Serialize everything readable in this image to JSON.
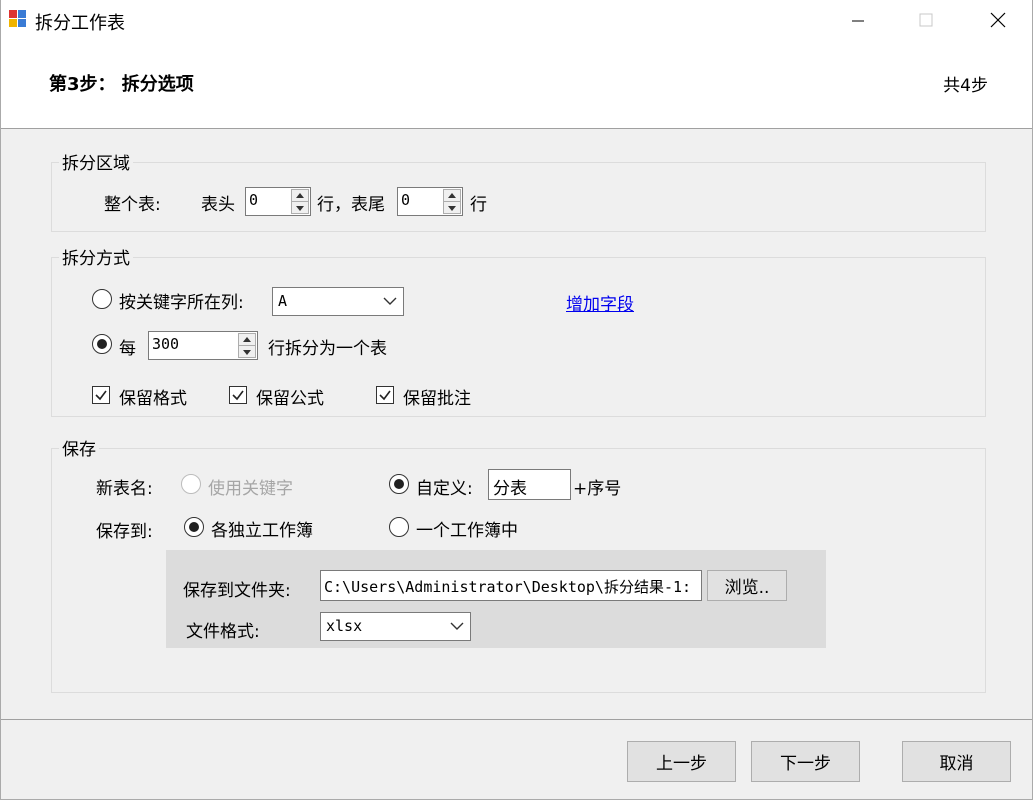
{
  "window": {
    "title": "拆分工作表",
    "minimize_glyph": "—",
    "close_glyph": "✕"
  },
  "header": {
    "step_title": "第3步： 拆分选项",
    "step_count": "共4步"
  },
  "split_range": {
    "legend": "拆分区域",
    "whole_sheet_label": "整个表:",
    "header_label": "表头",
    "header_rows": "0",
    "rows_suffix_1": "行，表尾",
    "footer_rows": "0",
    "rows_suffix_2": "行"
  },
  "split_method": {
    "legend": "拆分方式",
    "by_key_column_label": "按关键字所在列:",
    "by_key_column_checked": false,
    "key_column_value": "A",
    "add_field_link": "增加字段",
    "every_label": "每",
    "every_checked": true,
    "rows_per_sheet": "300",
    "rows_per_sheet_suffix": "行拆分为一个表",
    "keep_format_label": "保留格式",
    "keep_format_checked": true,
    "keep_formula_label": "保留公式",
    "keep_formula_checked": true,
    "keep_comment_label": "保留批注",
    "keep_comment_checked": true
  },
  "save": {
    "legend": "保存",
    "new_sheet_name_label": "新表名:",
    "use_keyword_label": "使用关键字",
    "custom_label": "自定义:",
    "custom_checked": true,
    "custom_value": "分表",
    "serial_suffix": "+序号",
    "save_to_label": "保存到:",
    "separate_workbooks_label": "各独立工作簿",
    "separate_workbooks_checked": true,
    "one_workbook_label": "一个工作簿中",
    "one_workbook_checked": false,
    "folder_label": "保存到文件夹:",
    "folder_value": "C:\\Users\\Administrator\\Desktop\\拆分结果-1:",
    "browse_label": "浏览..",
    "file_format_label": "文件格式:",
    "file_format_value": "xlsx"
  },
  "footer": {
    "prev_label": "上一步",
    "next_label": "下一步",
    "cancel_label": "取消"
  },
  "colors": {
    "link": "#0000ee",
    "window_bg": "#f0f0f0",
    "panel_bg": "#dcdcdc"
  }
}
